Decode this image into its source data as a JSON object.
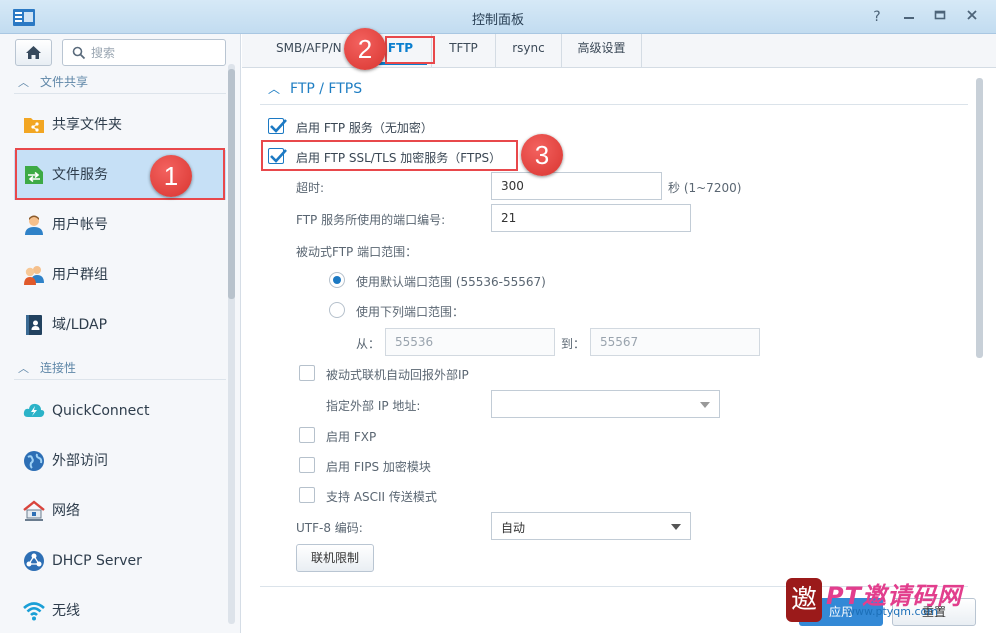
{
  "window": {
    "title": "控制面板",
    "help_icon": "?",
    "pin_icon": "pin-icon",
    "minimize_icon": "minimize-icon",
    "maximize_icon": "maximize-icon",
    "close_icon": "close-icon"
  },
  "sidebar": {
    "search_placeholder": "搜索",
    "groups": [
      {
        "label": "文件共享"
      },
      {
        "label": "连接性"
      }
    ],
    "items": [
      {
        "label": "共享文件夹",
        "icon": "shared-folder-icon"
      },
      {
        "label": "文件服务",
        "icon": "file-services-icon",
        "active": true
      },
      {
        "label": "用户帐号",
        "icon": "user-icon"
      },
      {
        "label": "用户群组",
        "icon": "group-icon"
      },
      {
        "label": "域/LDAP",
        "icon": "domain-ldap-icon"
      },
      {
        "label": "QuickConnect",
        "icon": "quickconnect-icon"
      },
      {
        "label": "外部访问",
        "icon": "external-access-icon"
      },
      {
        "label": "网络",
        "icon": "network-icon"
      },
      {
        "label": "DHCP Server",
        "icon": "dhcp-icon"
      },
      {
        "label": "无线",
        "icon": "wireless-icon"
      }
    ]
  },
  "tabs": [
    {
      "label": "SMB/AFP/N"
    },
    {
      "label": "FTP",
      "active": true
    },
    {
      "label": "TFTP"
    },
    {
      "label": "rsync"
    },
    {
      "label": "高级设置"
    }
  ],
  "ftp": {
    "section_title": "FTP / FTPS",
    "enable_ftp": {
      "label": "启用 FTP 服务（无加密）",
      "checked": true
    },
    "enable_ftps": {
      "label": "启用 FTP SSL/TLS 加密服务（FTPS）",
      "checked": true
    },
    "timeout": {
      "label": "超时:",
      "value": "300",
      "suffix": "秒 (1~7200)"
    },
    "port": {
      "label": "FTP 服务所使用的端口编号:",
      "value": "21"
    },
    "passive_range_label": "被动式FTP 端口范围：",
    "radio_default": {
      "label": "使用默认端口范围 (55536-55567)",
      "selected": true
    },
    "radio_custom": {
      "label": "使用下列端口范围：",
      "selected": false
    },
    "from_label": "从：",
    "from_value": "55536",
    "to_label": "到：",
    "to_value": "55567",
    "report_external_ip": {
      "label": "被动式联机自动回报外部IP",
      "checked": false
    },
    "external_ip_label": "指定外部 IP 地址:",
    "external_ip_value": "",
    "enable_fxp": {
      "label": "启用 FXP",
      "checked": false
    },
    "enable_fips": {
      "label": "启用 FIPS 加密模块",
      "checked": false
    },
    "ascii_mode": {
      "label": "支持 ASCII 传送模式",
      "checked": false
    },
    "utf8_label": "UTF-8 编码:",
    "utf8_value": "自动",
    "connection_limit_button": "联机限制"
  },
  "footer": {
    "apply_label": "应用",
    "reset_label": "重置"
  },
  "annotations": {
    "step1": "1",
    "step2": "2",
    "step3": "3",
    "highlight_color": "#e8484b"
  },
  "watermark": {
    "logo_char": "邀",
    "brand": "PT邀请码网",
    "url": "www.ptyqm.com"
  },
  "colors": {
    "accent": "#0b7fcf",
    "active_nav_bg": "#c6e0f6",
    "apply_button": "#3389d6"
  }
}
